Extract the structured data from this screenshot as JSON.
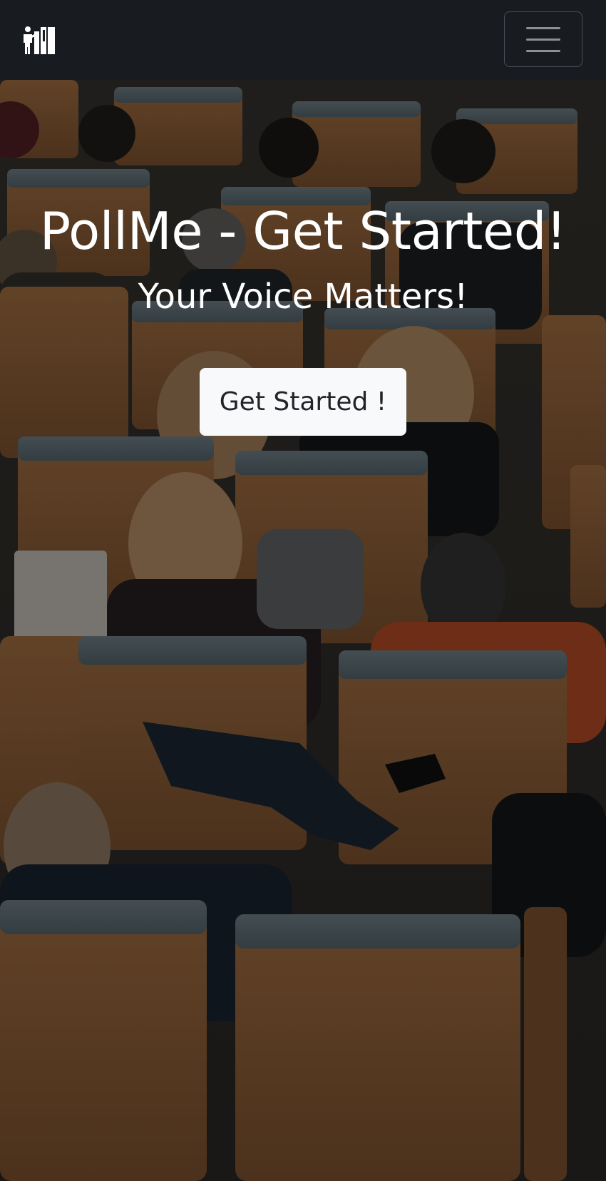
{
  "navbar": {
    "brand_icon": "people-voting-logo-icon",
    "toggler_icon": "hamburger-menu-icon",
    "background": "#181b20"
  },
  "hero": {
    "title": "PollMe - Get Started!",
    "subtitle": "Your Voice Matters!",
    "cta_label": "Get Started !",
    "background_image": "lecture-hall-audience-photo"
  },
  "colors": {
    "cta_background": "#f8f9fa",
    "cta_text": "#212529",
    "hero_text": "#ffffff"
  }
}
